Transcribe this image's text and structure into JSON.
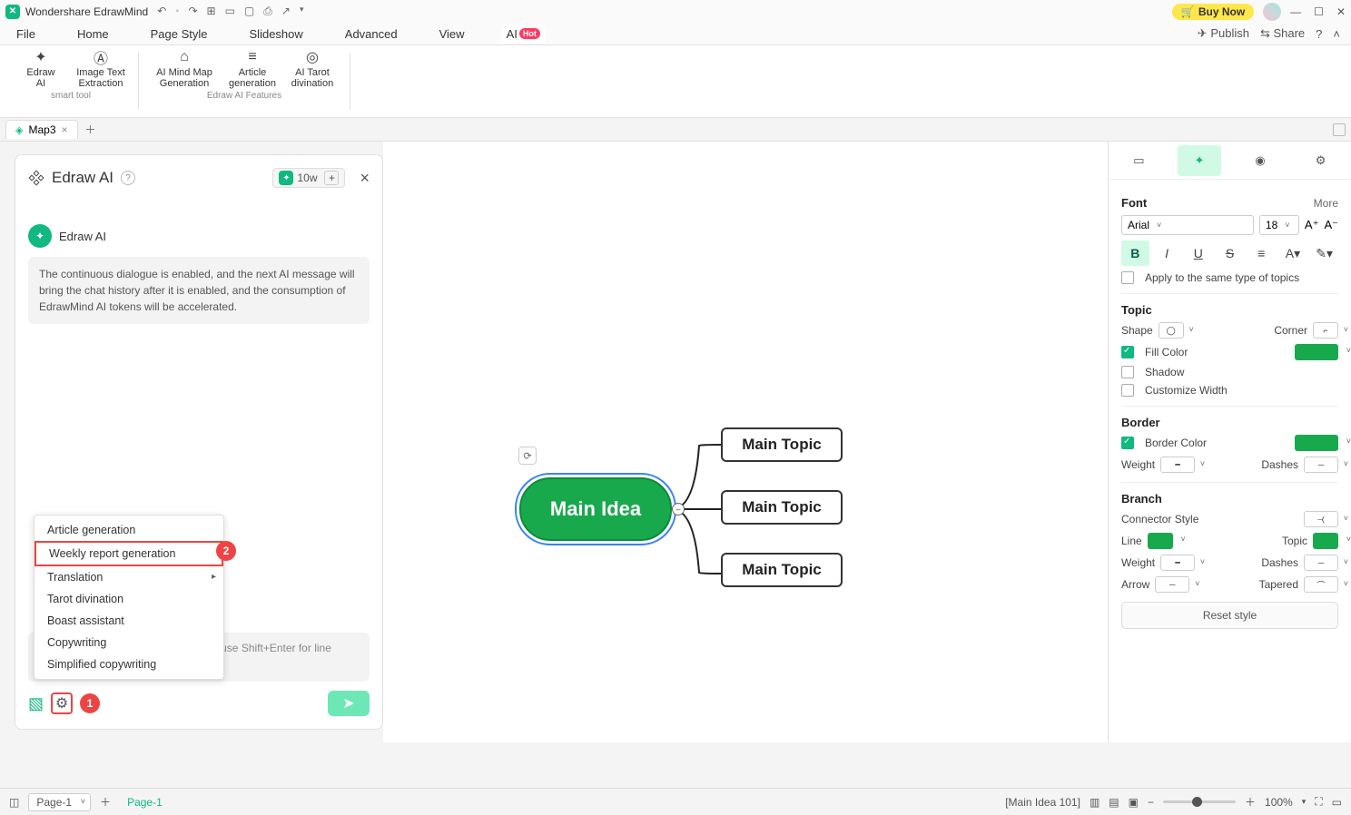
{
  "app": {
    "title": "Wondershare EdrawMind"
  },
  "titlebar": {
    "buy_now": "Buy Now"
  },
  "menu": {
    "file": "File",
    "home": "Home",
    "page_style": "Page Style",
    "slideshow": "Slideshow",
    "advanced": "Advanced",
    "view": "View",
    "ai": "AI",
    "hot": "Hot",
    "publish": "Publish",
    "share": "Share"
  },
  "ribbon": {
    "items": [
      {
        "line1": "Edraw",
        "line2": "AI"
      },
      {
        "line1": "Image Text",
        "line2": "Extraction"
      },
      {
        "line1": "AI Mind Map",
        "line2": "Generation"
      },
      {
        "line1": "Article",
        "line2": "generation"
      },
      {
        "line1": "AI Tarot",
        "line2": "divination"
      }
    ],
    "group1_label": "smart tool",
    "group2_label": "Edraw AI Features"
  },
  "doctabs": {
    "tab1": "Map3"
  },
  "aiPanel": {
    "title": "Edraw AI",
    "counter": "10w",
    "msg_sender": "Edraw AI",
    "msg_body": "The continuous dialogue is enabled, and the next AI message will bring the chat history after it is enabled, and the consumption of EdrawMind AI tokens will be accelerated.",
    "textarea_hint": "continuous free conversation ge, and use Shift+Enter for line",
    "popup": {
      "items": [
        "Article generation",
        "Weekly report generation",
        "Translation",
        "Tarot divination",
        "Boast assistant",
        "Copywriting",
        "Simplified copywriting"
      ]
    },
    "annot1": "1",
    "annot2": "2"
  },
  "mindmap": {
    "main_idea": "Main Idea",
    "topic1": "Main Topic",
    "topic2": "Main Topic",
    "topic3": "Main Topic"
  },
  "props": {
    "font_section": "Font",
    "more": "More",
    "font_family": "Arial",
    "font_size": "18",
    "apply_same": "Apply to the same type of topics",
    "topic_section": "Topic",
    "shape": "Shape",
    "corner": "Corner",
    "fill_color": "Fill Color",
    "shadow": "Shadow",
    "customize_width": "Customize Width",
    "border_section": "Border",
    "border_color": "Border Color",
    "weight": "Weight",
    "dashes": "Dashes",
    "branch_section": "Branch",
    "connector_style": "Connector Style",
    "line": "Line",
    "topic_color": "Topic",
    "arrow": "Arrow",
    "tapered": "Tapered",
    "reset": "Reset style"
  },
  "status": {
    "page_dd": "Page-1",
    "page_tab": "Page-1",
    "selection": "[Main Idea 101]",
    "zoom": "100%"
  }
}
